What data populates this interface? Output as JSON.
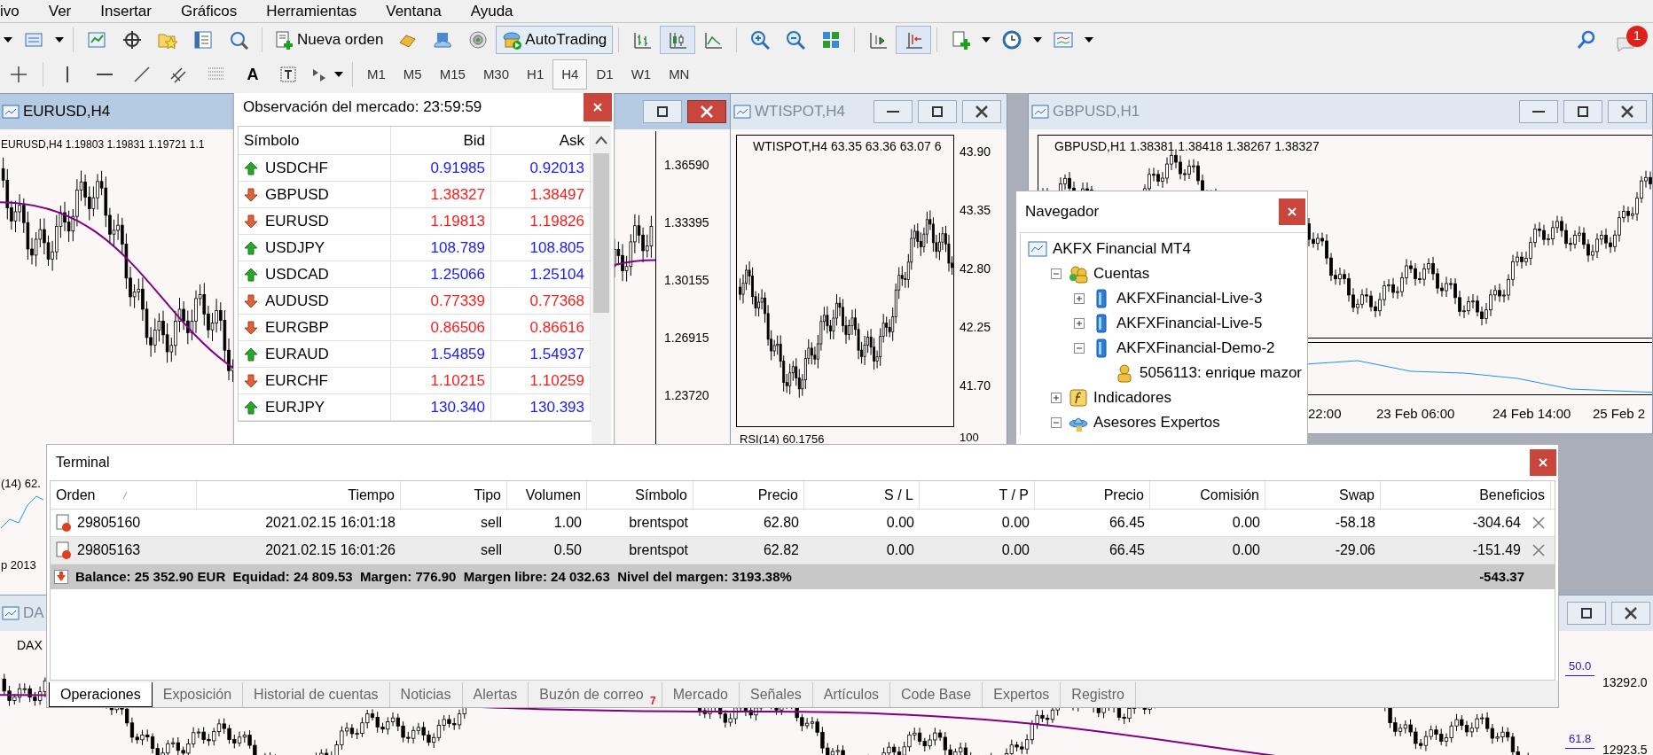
{
  "menu": [
    "ivo",
    "Ver",
    "Insertar",
    "Gráficos",
    "Herramientas",
    "Ventana",
    "Ayuda"
  ],
  "toolbar": {
    "buttons": [
      {
        "label": "Nueva orden",
        "pressed": false
      },
      {
        "label": "AutoTrading",
        "pressed": true
      }
    ],
    "notification_count": "1"
  },
  "drawing_toolbar": {
    "text_tool": "A",
    "timeframes": [
      {
        "label": "M1",
        "selected": false
      },
      {
        "label": "M5",
        "selected": false
      },
      {
        "label": "M15",
        "selected": false
      },
      {
        "label": "M30",
        "selected": false
      },
      {
        "label": "H1",
        "selected": false
      },
      {
        "label": "H4",
        "selected": true
      },
      {
        "label": "D1",
        "selected": false
      },
      {
        "label": "W1",
        "selected": false
      },
      {
        "label": "MN",
        "selected": false
      }
    ]
  },
  "charts": [
    {
      "title": "EURUSD,H4",
      "active": true,
      "info": "EURUSD,H4  1.19803 1.19831 1.19721 1.1",
      "price_labels": [
        "1.36590",
        "1.33395",
        "1.30155",
        "1.26915",
        "1.23720"
      ],
      "indicator_label": "(14) 62.",
      "time_labels": [
        "p 2013"
      ]
    },
    {
      "title": "WTISPOT,H4",
      "active": false,
      "info": "WTISPOT,H4  63.35 63.36 63.07 6",
      "price_labels": [
        "43.90",
        "43.35",
        "42.80",
        "42.25",
        "41.70"
      ],
      "indicator_label": "RSI(14) 60.1756",
      "indicator_scale": "100"
    },
    {
      "title": "GBPUSD,H1",
      "active": false,
      "info": "GBPUSD,H1  1.38381 1.38418 1.38267 1.38327",
      "time_labels": [
        "22:00",
        "23 Feb 06:00",
        "24 Feb 14:00",
        "25 Feb 2"
      ]
    },
    {
      "title": "DA",
      "active": false,
      "info": "DAX",
      "price_labels": [
        "13292.0",
        "12923.5"
      ],
      "level_labels": [
        "50.0",
        "61.8"
      ]
    }
  ],
  "market_watch": {
    "title": "Observación del mercado: 23:59:59",
    "columns": [
      "Símbolo",
      "Bid",
      "Ask"
    ],
    "rows": [
      {
        "symbol": "USDCHF",
        "bid": "0.91985",
        "ask": "0.92013",
        "up": true
      },
      {
        "symbol": "GBPUSD",
        "bid": "1.38327",
        "ask": "1.38497",
        "up": false
      },
      {
        "symbol": "EURUSD",
        "bid": "1.19813",
        "ask": "1.19826",
        "up": false
      },
      {
        "symbol": "USDJPY",
        "bid": "108.789",
        "ask": "108.805",
        "up": true
      },
      {
        "symbol": "USDCAD",
        "bid": "1.25066",
        "ask": "1.25104",
        "up": true
      },
      {
        "symbol": "AUDUSD",
        "bid": "0.77339",
        "ask": "0.77368",
        "up": false
      },
      {
        "symbol": "EURGBP",
        "bid": "0.86506",
        "ask": "0.86616",
        "up": false
      },
      {
        "symbol": "EURAUD",
        "bid": "1.54859",
        "ask": "1.54937",
        "up": true
      },
      {
        "symbol": "EURCHF",
        "bid": "1.10215",
        "ask": "1.10259",
        "up": false
      },
      {
        "symbol": "EURJPY",
        "bid": "130.340",
        "ask": "130.393",
        "up": true
      }
    ]
  },
  "navigator": {
    "title": "Navegador",
    "tree": [
      {
        "label": "AKFX Financial MT4",
        "kind": "terminal",
        "children": [
          {
            "label": "Cuentas",
            "kind": "accounts",
            "expanded": true,
            "children": [
              {
                "label": "AKFXFinancial-Live-3",
                "kind": "server",
                "expanded": false
              },
              {
                "label": "AKFXFinancial-Live-5",
                "kind": "server",
                "expanded": false
              },
              {
                "label": "AKFXFinancial-Demo-2",
                "kind": "server",
                "expanded": true,
                "children": [
                  {
                    "label": "5056113: enrique mazor",
                    "kind": "user"
                  }
                ]
              }
            ]
          },
          {
            "label": "Indicadores",
            "kind": "indicators",
            "expanded": false
          },
          {
            "label": "Asesores Expertos",
            "kind": "experts",
            "expanded": true
          }
        ]
      }
    ]
  },
  "terminal": {
    "title": "Terminal",
    "columns": [
      "Orden",
      "Tiempo",
      "Tipo",
      "Volumen",
      "Símbolo",
      "Precio",
      "S / L",
      "T / P",
      "Precio",
      "Comisión",
      "Swap",
      "Beneficios"
    ],
    "rows": [
      {
        "selected": false,
        "cells": [
          "29805160",
          "2021.02.15 16:01:18",
          "sell",
          "1.00",
          "brentspot",
          "62.80",
          "0.00",
          "0.00",
          "66.45",
          "0.00",
          "-58.18",
          "-304.64"
        ]
      },
      {
        "selected": true,
        "cells": [
          "29805163",
          "2021.02.15 16:01:26",
          "sell",
          "0.50",
          "brentspot",
          "62.82",
          "0.00",
          "0.00",
          "66.45",
          "0.00",
          "-29.06",
          "-151.49"
        ]
      }
    ],
    "summary": "Balance: 25 352.90 EUR  Equidad: 24 809.53  Margen: 776.90  Margen libre: 24 032.63  Nivel del margen: 3193.38%",
    "total": "-543.37",
    "tabs": [
      {
        "label": "Operaciones",
        "selected": true
      },
      {
        "label": "Exposición",
        "selected": false
      },
      {
        "label": "Historial de cuentas",
        "selected": false
      },
      {
        "label": "Noticias",
        "selected": false
      },
      {
        "label": "Alertas",
        "selected": false
      },
      {
        "label": "Buzón de correo",
        "selected": false,
        "badge": "7"
      },
      {
        "label": "Mercado",
        "selected": false
      },
      {
        "label": "Señales",
        "selected": false
      },
      {
        "label": "Artículos",
        "selected": false
      },
      {
        "label": "Code Base",
        "selected": false
      },
      {
        "label": "Expertos",
        "selected": false
      },
      {
        "label": "Registro",
        "selected": false
      }
    ]
  }
}
